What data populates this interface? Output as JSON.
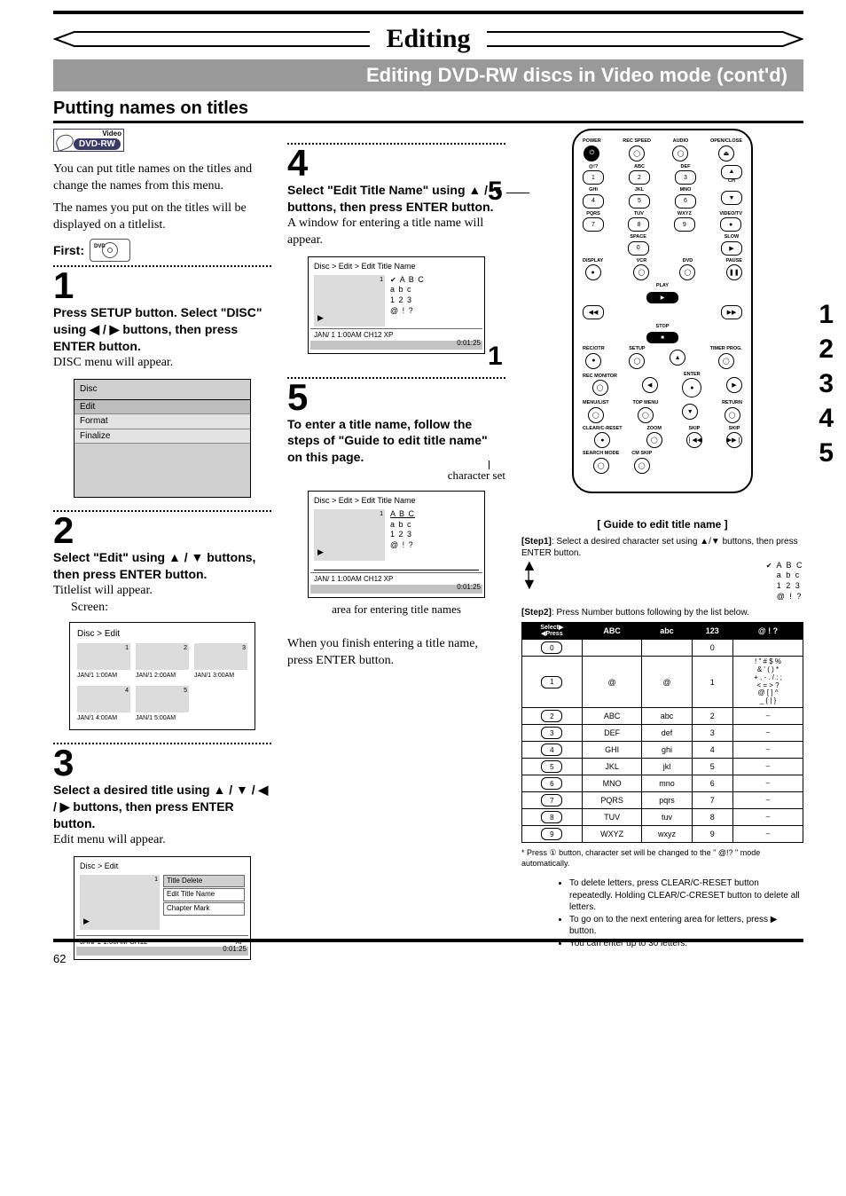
{
  "page_number": "62",
  "main_title": "Editing",
  "subtitle": "Editing DVD-RW discs in Video mode (cont'd)",
  "section_heading": "Putting names on titles",
  "badge": {
    "top": "Video",
    "label": "DVD-RW"
  },
  "intro1": "You can put title names on the titles and change the names from this menu.",
  "intro2": "The names you put on the titles will be displayed on a titlelist.",
  "first_label": "First:",
  "step1": {
    "num": "1",
    "head": "Press SETUP button. Select \"DISC\" using ◀ / ▶ buttons, then press ENTER button.",
    "body": "DISC menu will appear.",
    "menu": {
      "title": "Disc",
      "items": [
        "Edit",
        "Format",
        "Finalize"
      ],
      "selected": 0
    }
  },
  "step2": {
    "num": "2",
    "head": "Select \"Edit\" using ▲ / ▼ buttons, then press ENTER button.",
    "body": "Titlelist will appear.",
    "screen_label": "Screen:",
    "tl": {
      "title": "Disc > Edit",
      "items": [
        {
          "n": "1",
          "cap": "JAN/1  1:00AM"
        },
        {
          "n": "2",
          "cap": "JAN/1  2:00AM"
        },
        {
          "n": "3",
          "cap": "JAN/1  3:00AM"
        },
        {
          "n": "4",
          "cap": "JAN/1  4:00AM"
        },
        {
          "n": "5",
          "cap": "JAN/1  5:00AM"
        }
      ]
    }
  },
  "step3": {
    "num": "3",
    "head": "Select a desired title using ▲ / ▼ / ◀ / ▶ buttons, then press ENTER button.",
    "body": "Edit menu will appear.",
    "em": {
      "title": "Disc > Edit",
      "n": "1",
      "opts": [
        "Title Delete",
        "Edit Title Name",
        "Chapter Mark"
      ],
      "foot_l": "JAN/ 1   1:00AM  CH12",
      "foot_r": "XP",
      "time": "0:01:25"
    }
  },
  "step4": {
    "num": "4",
    "head": "Select \"Edit Title Name\" using ▲ / ▼ buttons, then press ENTER button.",
    "body": "A window for entering a title name will appear.",
    "etn_title": "Disc > Edit > Edit Title Name",
    "n": "1",
    "sets": [
      "A B C",
      "a b c",
      "1 2 3",
      "@ ! ?"
    ],
    "foot": "JAN/ 1   1:00AM   CH12   XP",
    "time": "0:01:25"
  },
  "step5": {
    "num": "5",
    "head": "To enter a title name, follow the steps of \"Guide to edit title name\" on this page.",
    "ann_charset": "character set",
    "ann_area": "area for entering title names",
    "tail": "When you finish entering a title name, press ENTER button."
  },
  "remote": {
    "r1": [
      {
        "l": "POWER"
      },
      {
        "l": "REC SPEED"
      },
      {
        "l": "AUDIO"
      },
      {
        "l": "OPEN/CLOSE"
      }
    ],
    "nums_top": [
      [
        {
          "l": "@!?",
          "n": "1"
        },
        {
          "l": "ABC",
          "n": "2"
        },
        {
          "l": "DEF",
          "n": "3"
        },
        {
          "l": "",
          "n": "▲",
          "sub": "CH"
        }
      ],
      [
        {
          "l": "GHI",
          "n": "4"
        },
        {
          "l": "JKL",
          "n": "5"
        },
        {
          "l": "MNO",
          "n": "6"
        },
        {
          "l": "",
          "n": "▼",
          "sub": ""
        }
      ],
      [
        {
          "l": "PQRS",
          "n": "7"
        },
        {
          "l": "TUV",
          "n": "8"
        },
        {
          "l": "WXYZ",
          "n": "9"
        },
        {
          "l": "VIDEO/TV",
          "n": "●"
        }
      ]
    ],
    "row_space": [
      {
        "l": "",
        "spacer": true
      },
      {
        "l": "SPACE",
        "n": "0"
      },
      {
        "l": "",
        "spacer": true
      },
      {
        "l": "SLOW",
        "n": "▶"
      }
    ],
    "row_disp": [
      {
        "l": "DISPLAY",
        "n": "●"
      },
      {
        "l": "VCR",
        "n": "◯"
      },
      {
        "l": "DVD",
        "n": "◯"
      },
      {
        "l": "PAUSE",
        "n": "❚❚"
      }
    ],
    "play": "PLAY",
    "stop": "STOP",
    "rec_row": [
      {
        "l": "REC/OTR"
      },
      {
        "l": "SETUP"
      },
      {
        "l": ""
      },
      {
        "l": "TIMER PROG."
      }
    ],
    "enter": "ENTER",
    "monitor_row": [
      {
        "l": "REC MONITOR"
      },
      {
        "l": ""
      },
      {
        "l": ""
      },
      {
        "l": ""
      }
    ],
    "menu_row": [
      {
        "l": "MENU/LIST"
      },
      {
        "l": "TOP MENU"
      },
      {
        "l": ""
      },
      {
        "l": "RETURN"
      }
    ],
    "bottom_row": [
      {
        "l": "CLEAR/C-RESET"
      },
      {
        "l": "ZOOM"
      },
      {
        "l": "SKIP"
      },
      {
        "l": "SKIP"
      }
    ],
    "search": "SEARCH MODE",
    "cm": "CM SKIP"
  },
  "side_markers": [
    "1",
    "2",
    "3",
    "4",
    "5"
  ],
  "guide": {
    "title": "[ Guide to edit title name ]",
    "s1_label": "[Step1]",
    "s1_text": ": Select a desired character set using ▲/▼ buttons, then press ENTER button.",
    "sets": [
      "A B C",
      "a b c",
      "1 2 3",
      "@ ! ?"
    ],
    "s2_label": "[Step2]",
    "s2_text": ": Press Number buttons following by the list below.",
    "tbl_head": {
      "corner": "Select ▶\n◀ Press",
      "c1": "ABC",
      "c2": "abc",
      "c3": "123",
      "c4": "@  !  ?"
    },
    "rows": [
      {
        "k": "0",
        "abc": "<space>",
        "low": "<space>",
        "num": "0",
        "sym": "<space>"
      },
      {
        "k": "1",
        "abc": "@",
        "low": "@",
        "num": "1",
        "sym": "! \" # $ %\n& ' ( ) *\n+ , - . / : ;\n< = > ?\n@ [ ] ^\n_ { | }"
      },
      {
        "k": "2",
        "abc": "ABC",
        "low": "abc",
        "num": "2",
        "sym": "–"
      },
      {
        "k": "3",
        "abc": "DEF",
        "low": "def",
        "num": "3",
        "sym": "–"
      },
      {
        "k": "4",
        "abc": "GHI",
        "low": "ghi",
        "num": "4",
        "sym": "–"
      },
      {
        "k": "5",
        "abc": "JKL",
        "low": "jkl",
        "num": "5",
        "sym": "–"
      },
      {
        "k": "6",
        "abc": "MNO",
        "low": "mno",
        "num": "6",
        "sym": "–"
      },
      {
        "k": "7",
        "abc": "PQRS",
        "low": "pqrs",
        "num": "7",
        "sym": "–"
      },
      {
        "k": "8",
        "abc": "TUV",
        "low": "tuv",
        "num": "8",
        "sym": "–"
      },
      {
        "k": "9",
        "abc": "WXYZ",
        "low": "wxyz",
        "num": "9",
        "sym": "–"
      }
    ],
    "footnote": "* Press ① button, character set will be changed to the \" @!? \" mode automatically."
  },
  "notes": [
    "To delete letters, press CLEAR/C-RESET button repeatedly. Holding CLEAR/C-CRESET button to delete all letters.",
    "To go on to the next entering area for letters, press ▶ button.",
    "You can enter up to 30 letters."
  ]
}
